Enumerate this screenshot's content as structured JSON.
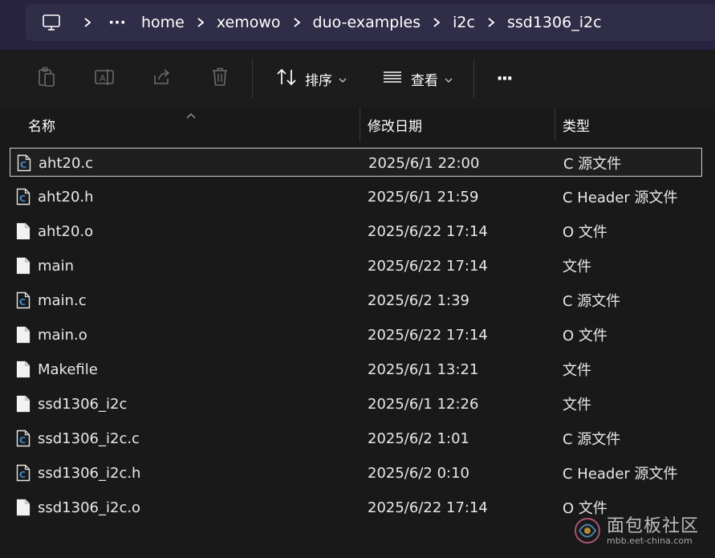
{
  "breadcrumb": {
    "more": "···",
    "items": [
      "home",
      "xemowo",
      "duo-examples",
      "i2c",
      "ssd1306_i2c"
    ]
  },
  "toolbar": {
    "sort_label": "排序",
    "view_label": "查看",
    "more_label": "···"
  },
  "columns": {
    "name": "名称",
    "date": "修改日期",
    "type": "类型"
  },
  "files": [
    {
      "name": "aht20.c",
      "date": "2025/6/1 22:00",
      "type": "C 源文件",
      "icon": "c-source-file-icon"
    },
    {
      "name": "aht20.h",
      "date": "2025/6/1 21:59",
      "type": "C Header 源文件",
      "icon": "c-header-file-icon"
    },
    {
      "name": "aht20.o",
      "date": "2025/6/22 17:14",
      "type": "O 文件",
      "icon": "generic-file-icon"
    },
    {
      "name": "main",
      "date": "2025/6/22 17:14",
      "type": "文件",
      "icon": "generic-file-icon"
    },
    {
      "name": "main.c",
      "date": "2025/6/2 1:39",
      "type": "C 源文件",
      "icon": "c-source-file-icon"
    },
    {
      "name": "main.o",
      "date": "2025/6/22 17:14",
      "type": "O 文件",
      "icon": "generic-file-icon"
    },
    {
      "name": "Makefile",
      "date": "2025/6/1 13:21",
      "type": "文件",
      "icon": "generic-file-icon"
    },
    {
      "name": "ssd1306_i2c",
      "date": "2025/6/1 12:26",
      "type": "文件",
      "icon": "generic-file-icon"
    },
    {
      "name": "ssd1306_i2c.c",
      "date": "2025/6/2 1:01",
      "type": "C 源文件",
      "icon": "c-source-file-icon"
    },
    {
      "name": "ssd1306_i2c.h",
      "date": "2025/6/2 0:10",
      "type": "C Header 源文件",
      "icon": "c-header-file-icon"
    },
    {
      "name": "ssd1306_i2c.o",
      "date": "2025/6/22 17:14",
      "type": "O 文件",
      "icon": "generic-file-icon"
    }
  ],
  "selected_index": 0,
  "watermark": {
    "text": "面包板社区",
    "url_text": "mbb.eet-china.com"
  },
  "colors": {
    "topbar_bg": "#262240",
    "address_bg": "#2f2d47",
    "content_bg": "#191919",
    "c_icon_accent": "#3f8fd6"
  }
}
